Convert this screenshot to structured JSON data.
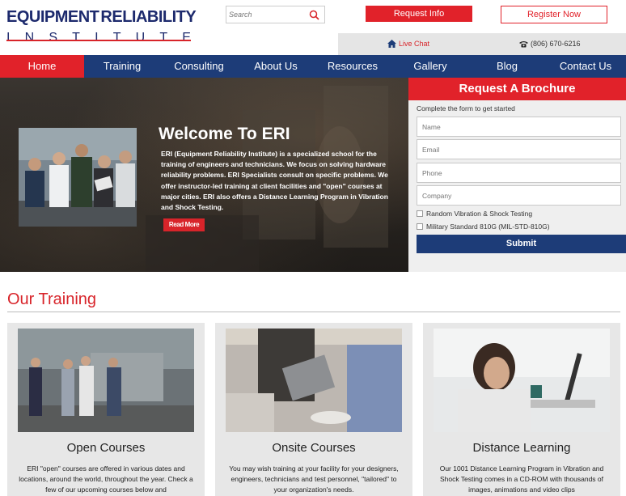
{
  "header": {
    "logo_top_left": "EQUIPMENT",
    "logo_top_right": "RELIABILITY",
    "logo_bottom_letters": [
      "I",
      "N",
      "S",
      "T",
      "I",
      "T",
      "U",
      "T",
      "E"
    ],
    "search_placeholder": "Search",
    "request_info_label": "Request Info",
    "register_label": "Register Now",
    "live_chat_label": "Live Chat",
    "phone_label": "(806) 670-6216"
  },
  "nav": {
    "items": [
      {
        "label": "Home",
        "active": true
      },
      {
        "label": "Training"
      },
      {
        "label": "Consulting"
      },
      {
        "label": "About Us"
      },
      {
        "label": "Resources"
      },
      {
        "label": "Gallery"
      },
      {
        "label": "Blog"
      },
      {
        "label": "Contact Us"
      }
    ]
  },
  "hero": {
    "title": "Welcome To ERI",
    "text": "ERI (Equipment Reliability Institute) is a specialized school for the training of engineers and technicians. We focus on solving hardware reliability problems. ERI Specialists consult on specific problems. We offer instructor-led training at client facilities and \"open\" courses at major cities. ERI also offers a Distance Learning Program in Vibration and Shock Testing.",
    "read_more_label": "Read More"
  },
  "brochure": {
    "title": "Request A Brochure",
    "subtitle": "Complete the form to get started",
    "name_placeholder": "Name",
    "email_placeholder": "Email",
    "phone_placeholder": "Phone",
    "company_placeholder": "Company",
    "option_1": "Random Vibration & Shock Testing",
    "option_2": "Military Standard 810G (MIL-STD-810G)",
    "submit_label": "Submit"
  },
  "training": {
    "section_title": "Our Training",
    "cards": [
      {
        "title": "Open Courses",
        "text": "ERI \"open\" courses are offered in various dates and locations, around the world, throughout the year. Check a few of our upcoming courses below and"
      },
      {
        "title": "Onsite Courses",
        "text": "You may wish training at your facility for your designers, engineers, technicians and test personnel, \"tailored\" to your organization's needs."
      },
      {
        "title": "Distance Learning",
        "text": "Our 1001 Distance Learning Program in Vibration and Shock Testing comes in a CD-ROM with thousands of images, animations and video clips"
      }
    ]
  },
  "colors": {
    "brand_red": "#e1222a",
    "brand_navy": "#1d3c78"
  }
}
